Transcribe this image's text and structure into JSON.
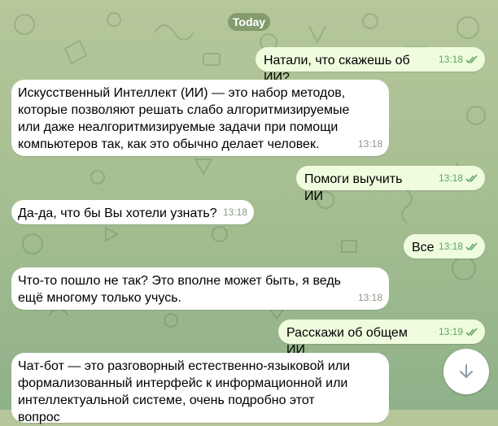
{
  "chat": {
    "date": "Today",
    "messages": [
      {
        "direction": "outgoing",
        "text": "Натали, что скажешь об ИИ?",
        "time": "13:18",
        "read": true
      },
      {
        "direction": "incoming",
        "text": "Искусственный Интеллект (ИИ) — это набор методов, которые позволяют решать слабо алгоритмизируемые или даже неалгоритмизируемые задачи при помощи компьютеров так, как это обычно делает человек.",
        "time": "13:18"
      },
      {
        "direction": "outgoing",
        "text": "Помоги выучить ИИ",
        "time": "13:18",
        "read": true
      },
      {
        "direction": "incoming",
        "text": "Да-да, что бы Вы хотели узнать?",
        "time": "13:18"
      },
      {
        "direction": "outgoing",
        "text": "Все",
        "time": "13:18",
        "read": true
      },
      {
        "direction": "incoming",
        "text": "Что-то пошло не так? Это вполне может быть, я ведь ещё многому только учусь.",
        "time": "13:18"
      },
      {
        "direction": "outgoing",
        "text": "Расскажи об общем ИИ",
        "time": "13:19",
        "read": true
      },
      {
        "direction": "incoming",
        "text": "Чат-бот — это разговорный естественно-языковой или формализованный интерфейс к информационной или интеллектуальной системе, очень подробно этот вопрос",
        "time": ""
      }
    ]
  },
  "icons": {
    "read_receipt": "double-check-icon",
    "scroll_down": "arrow-down-icon"
  },
  "colors": {
    "background": "#a7bf92",
    "incoming_bubble": "#ffffff",
    "outgoing_bubble": "#effdde",
    "outgoing_meta": "#5fa563",
    "incoming_meta": "#8c9a88",
    "date_chip": "#6c8a59"
  }
}
